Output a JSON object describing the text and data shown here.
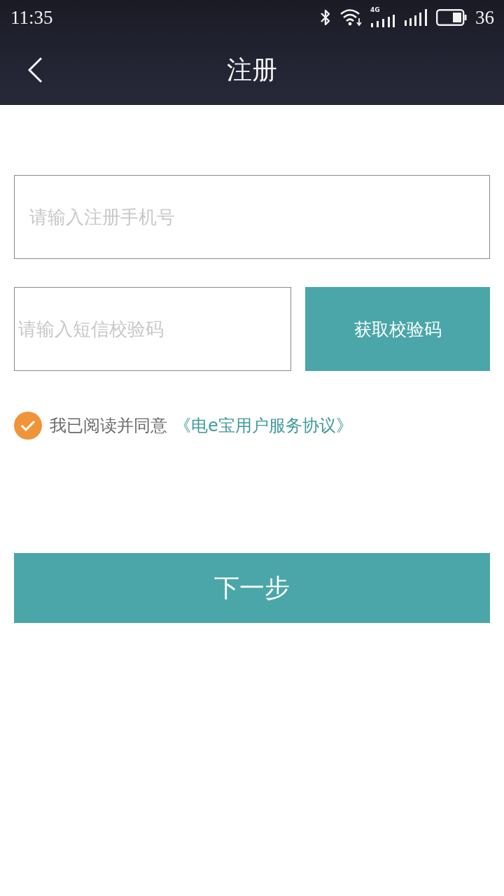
{
  "status_bar": {
    "time": "11:35",
    "network": "4G",
    "battery": "36"
  },
  "header": {
    "title": "注册"
  },
  "form": {
    "phone_field": {
      "placeholder": "请输入注册手机号"
    },
    "code_field": {
      "placeholder": "请输入短信校验码"
    },
    "get_code_button": "获取校验码"
  },
  "agreement": {
    "checked": true,
    "text": "我已阅读并同意",
    "link": "《电e宝用户服务协议》"
  },
  "next_button": "下一步"
}
